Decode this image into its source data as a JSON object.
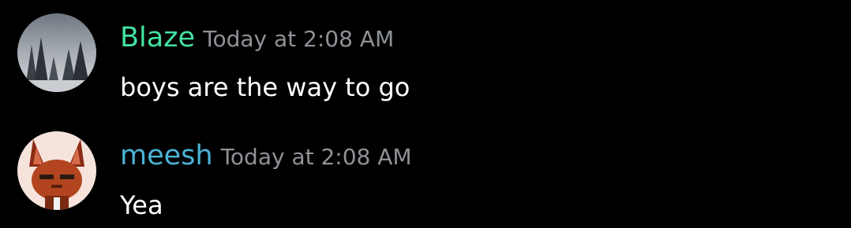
{
  "messages": [
    {
      "author": "Blaze",
      "author_color": "#43e3a0",
      "timestamp": "Today at 2:08 AM",
      "text": "boys are the way to go",
      "avatar": "winter-forest-avatar"
    },
    {
      "author": "meesh",
      "author_color": "#4bb3d6",
      "timestamp": "Today at 2:08 AM",
      "text": "Yea",
      "avatar": "fox-character-avatar"
    }
  ],
  "colors": {
    "background": "#000000",
    "timestamp": "#8e9297",
    "message_text": "#ffffff"
  }
}
